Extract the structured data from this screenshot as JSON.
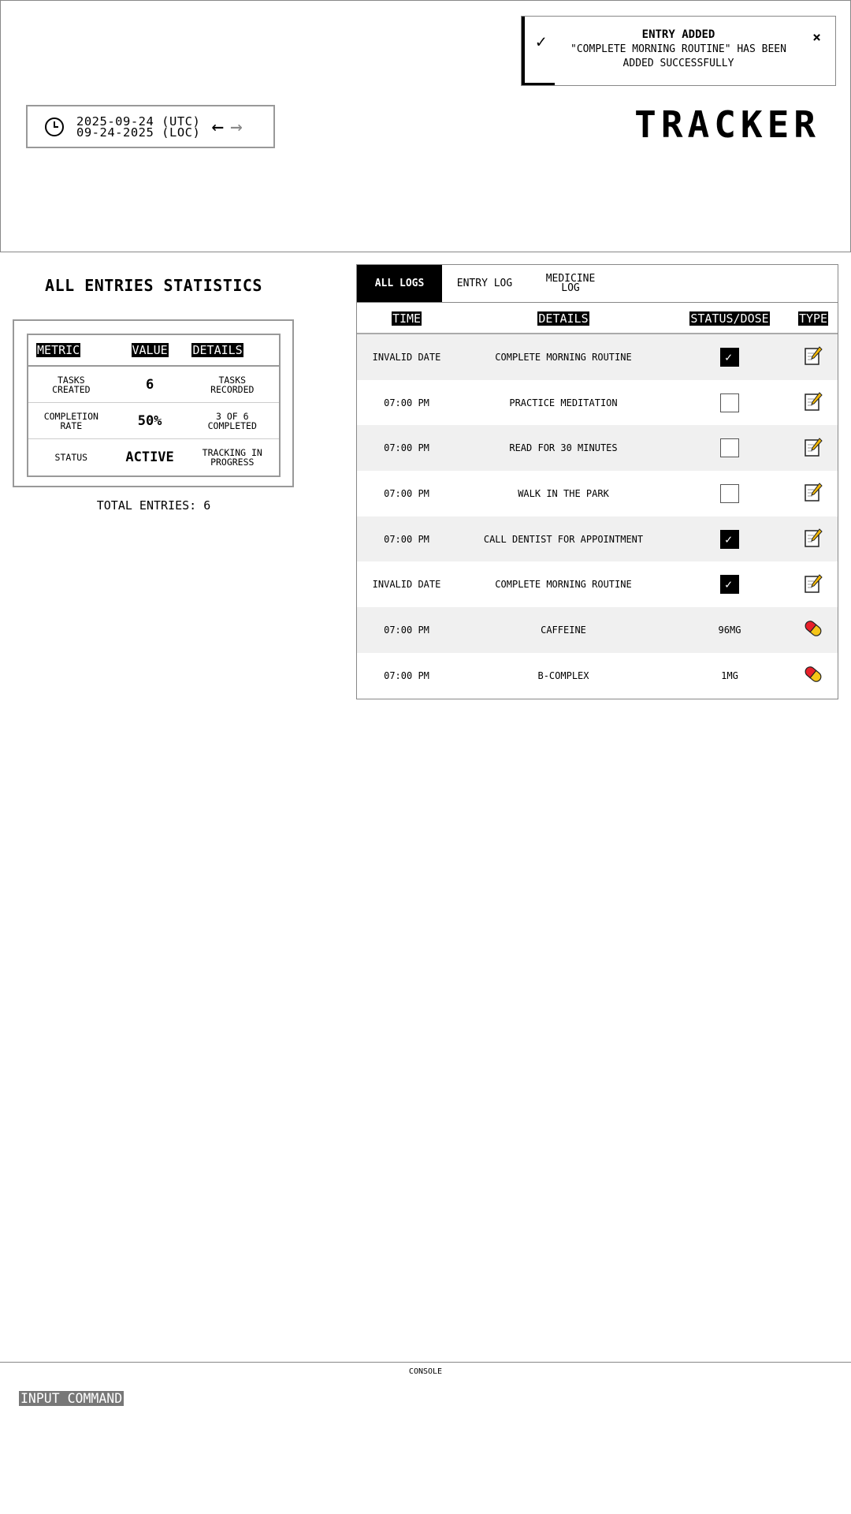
{
  "header": {
    "brand": "TRACKER",
    "date_utc": "2025-09-24 (UTC)",
    "date_loc": "09-24-2025 (LOC)",
    "prev_arrow": "←",
    "next_arrow": "→",
    "icons": [
      "clock-icon",
      "arrow-left-icon",
      "arrow-right-icon"
    ]
  },
  "toast": {
    "check": "✓",
    "title": "ENTRY ADDED",
    "message_line1": "\"COMPLETE MORNING ROUTINE\" HAS BEEN",
    "message_line2": "ADDED SUCCESSFULLY",
    "close": "×"
  },
  "stats": {
    "title": "ALL ENTRIES STATISTICS",
    "headers": {
      "metric": "METRIC",
      "value": "VALUE",
      "details": "DETAILS"
    },
    "rows": [
      {
        "metric_l1": "TASKS",
        "metric_l2": "CREATED",
        "value": "6",
        "details_l1": "TASKS",
        "details_l2": "RECORDED"
      },
      {
        "metric_l1": "COMPLETION",
        "metric_l2": "RATE",
        "value": "50%",
        "details_l1": "3 OF 6",
        "details_l2": "COMPLETED"
      },
      {
        "metric_l1": "STATUS",
        "metric_l2": "",
        "value": "ACTIVE",
        "details_l1": "TRACKING IN",
        "details_l2": "PROGRESS"
      }
    ],
    "total": "TOTAL ENTRIES: 6"
  },
  "logs": {
    "tabs": [
      {
        "label_l1": "ALL LOGS",
        "label_l2": "",
        "active": true
      },
      {
        "label_l1": "ENTRY LOG",
        "label_l2": "",
        "active": false
      },
      {
        "label_l1": "MEDICINE",
        "label_l2": "LOG",
        "active": false
      }
    ],
    "headers": {
      "time": "TIME",
      "details": "DETAILS",
      "status": "STATUS/DOSE",
      "type": "TYPE"
    },
    "rows": [
      {
        "time": "INVALID DATE",
        "details": "COMPLETE MORNING ROUTINE",
        "kind": "entry",
        "checked": true,
        "dose": ""
      },
      {
        "time": "07:00 PM",
        "details": "PRACTICE MEDITATION",
        "kind": "entry",
        "checked": false,
        "dose": ""
      },
      {
        "time": "07:00 PM",
        "details": "READ FOR 30 MINUTES",
        "kind": "entry",
        "checked": false,
        "dose": ""
      },
      {
        "time": "07:00 PM",
        "details": "WALK IN THE PARK",
        "kind": "entry",
        "checked": false,
        "dose": ""
      },
      {
        "time": "07:00 PM",
        "details": "CALL DENTIST FOR APPOINTMENT",
        "kind": "entry",
        "checked": true,
        "dose": ""
      },
      {
        "time": "INVALID DATE",
        "details": "COMPLETE MORNING ROUTINE",
        "kind": "entry",
        "checked": true,
        "dose": ""
      },
      {
        "time": "07:00 PM",
        "details": "CAFFEINE",
        "kind": "medicine",
        "checked": false,
        "dose": "96MG"
      },
      {
        "time": "07:00 PM",
        "details": "B-COMPLEX",
        "kind": "medicine",
        "checked": false,
        "dose": "1MG"
      }
    ],
    "type_icons": {
      "entry": "memo-icon",
      "medicine": "pill-icon"
    }
  },
  "console": {
    "label": "CONSOLE",
    "input_placeholder": "INPUT COMMAND"
  },
  "colors": {
    "accent": "#000000",
    "pill_red": "#e8202a",
    "pill_yellow": "#f5c518",
    "memo_pencil": "#f2b705",
    "console_input_bg": "#777777"
  }
}
